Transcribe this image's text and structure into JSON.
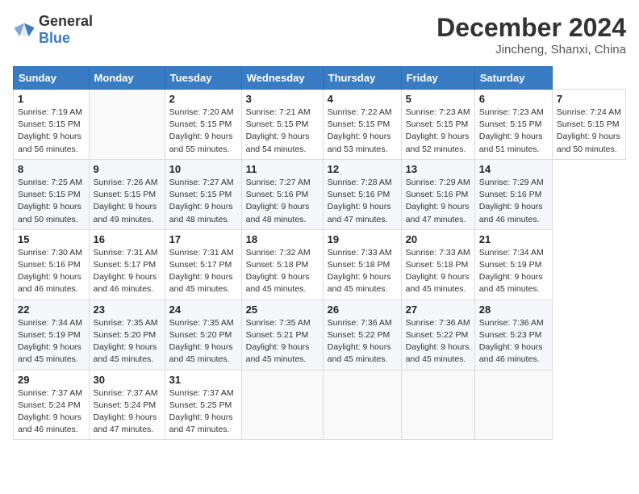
{
  "header": {
    "logo": {
      "general": "General",
      "blue": "Blue"
    },
    "title": "December 2024",
    "location": "Jincheng, Shanxi, China"
  },
  "calendar": {
    "weekdays": [
      "Sunday",
      "Monday",
      "Tuesday",
      "Wednesday",
      "Thursday",
      "Friday",
      "Saturday"
    ],
    "weeks": [
      [
        null,
        {
          "day": 2,
          "sunrise": "7:20 AM",
          "sunset": "5:15 PM",
          "daylight_hours": "9 hours",
          "daylight_minutes": "55 minutes"
        },
        {
          "day": 3,
          "sunrise": "7:21 AM",
          "sunset": "5:15 PM",
          "daylight_hours": "9 hours",
          "daylight_minutes": "54 minutes"
        },
        {
          "day": 4,
          "sunrise": "7:22 AM",
          "sunset": "5:15 PM",
          "daylight_hours": "9 hours",
          "daylight_minutes": "53 minutes"
        },
        {
          "day": 5,
          "sunrise": "7:23 AM",
          "sunset": "5:15 PM",
          "daylight_hours": "9 hours",
          "daylight_minutes": "52 minutes"
        },
        {
          "day": 6,
          "sunrise": "7:23 AM",
          "sunset": "5:15 PM",
          "daylight_hours": "9 hours",
          "daylight_minutes": "51 minutes"
        },
        {
          "day": 7,
          "sunrise": "7:24 AM",
          "sunset": "5:15 PM",
          "daylight_hours": "9 hours",
          "daylight_minutes": "50 minutes"
        }
      ],
      [
        {
          "day": 8,
          "sunrise": "7:25 AM",
          "sunset": "5:15 PM",
          "daylight_hours": "9 hours",
          "daylight_minutes": "50 minutes"
        },
        {
          "day": 9,
          "sunrise": "7:26 AM",
          "sunset": "5:15 PM",
          "daylight_hours": "9 hours",
          "daylight_minutes": "49 minutes"
        },
        {
          "day": 10,
          "sunrise": "7:27 AM",
          "sunset": "5:15 PM",
          "daylight_hours": "9 hours",
          "daylight_minutes": "48 minutes"
        },
        {
          "day": 11,
          "sunrise": "7:27 AM",
          "sunset": "5:16 PM",
          "daylight_hours": "9 hours",
          "daylight_minutes": "48 minutes"
        },
        {
          "day": 12,
          "sunrise": "7:28 AM",
          "sunset": "5:16 PM",
          "daylight_hours": "9 hours",
          "daylight_minutes": "47 minutes"
        },
        {
          "day": 13,
          "sunrise": "7:29 AM",
          "sunset": "5:16 PM",
          "daylight_hours": "9 hours",
          "daylight_minutes": "47 minutes"
        },
        {
          "day": 14,
          "sunrise": "7:29 AM",
          "sunset": "5:16 PM",
          "daylight_hours": "9 hours",
          "daylight_minutes": "46 minutes"
        }
      ],
      [
        {
          "day": 15,
          "sunrise": "7:30 AM",
          "sunset": "5:16 PM",
          "daylight_hours": "9 hours",
          "daylight_minutes": "46 minutes"
        },
        {
          "day": 16,
          "sunrise": "7:31 AM",
          "sunset": "5:17 PM",
          "daylight_hours": "9 hours",
          "daylight_minutes": "46 minutes"
        },
        {
          "day": 17,
          "sunrise": "7:31 AM",
          "sunset": "5:17 PM",
          "daylight_hours": "9 hours",
          "daylight_minutes": "45 minutes"
        },
        {
          "day": 18,
          "sunrise": "7:32 AM",
          "sunset": "5:18 PM",
          "daylight_hours": "9 hours",
          "daylight_minutes": "45 minutes"
        },
        {
          "day": 19,
          "sunrise": "7:33 AM",
          "sunset": "5:18 PM",
          "daylight_hours": "9 hours",
          "daylight_minutes": "45 minutes"
        },
        {
          "day": 20,
          "sunrise": "7:33 AM",
          "sunset": "5:18 PM",
          "daylight_hours": "9 hours",
          "daylight_minutes": "45 minutes"
        },
        {
          "day": 21,
          "sunrise": "7:34 AM",
          "sunset": "5:19 PM",
          "daylight_hours": "9 hours",
          "daylight_minutes": "45 minutes"
        }
      ],
      [
        {
          "day": 22,
          "sunrise": "7:34 AM",
          "sunset": "5:19 PM",
          "daylight_hours": "9 hours",
          "daylight_minutes": "45 minutes"
        },
        {
          "day": 23,
          "sunrise": "7:35 AM",
          "sunset": "5:20 PM",
          "daylight_hours": "9 hours",
          "daylight_minutes": "45 minutes"
        },
        {
          "day": 24,
          "sunrise": "7:35 AM",
          "sunset": "5:20 PM",
          "daylight_hours": "9 hours",
          "daylight_minutes": "45 minutes"
        },
        {
          "day": 25,
          "sunrise": "7:35 AM",
          "sunset": "5:21 PM",
          "daylight_hours": "9 hours",
          "daylight_minutes": "45 minutes"
        },
        {
          "day": 26,
          "sunrise": "7:36 AM",
          "sunset": "5:22 PM",
          "daylight_hours": "9 hours",
          "daylight_minutes": "45 minutes"
        },
        {
          "day": 27,
          "sunrise": "7:36 AM",
          "sunset": "5:22 PM",
          "daylight_hours": "9 hours",
          "daylight_minutes": "45 minutes"
        },
        {
          "day": 28,
          "sunrise": "7:36 AM",
          "sunset": "5:23 PM",
          "daylight_hours": "9 hours",
          "daylight_minutes": "46 minutes"
        }
      ],
      [
        {
          "day": 29,
          "sunrise": "7:37 AM",
          "sunset": "5:24 PM",
          "daylight_hours": "9 hours",
          "daylight_minutes": "46 minutes"
        },
        {
          "day": 30,
          "sunrise": "7:37 AM",
          "sunset": "5:24 PM",
          "daylight_hours": "9 hours",
          "daylight_minutes": "47 minutes"
        },
        {
          "day": 31,
          "sunrise": "7:37 AM",
          "sunset": "5:25 PM",
          "daylight_hours": "9 hours",
          "daylight_minutes": "47 minutes"
        },
        null,
        null,
        null,
        null
      ]
    ],
    "first_day": {
      "day": 1,
      "sunrise": "7:19 AM",
      "sunset": "5:15 PM",
      "daylight_hours": "9 hours",
      "daylight_minutes": "56 minutes"
    }
  }
}
